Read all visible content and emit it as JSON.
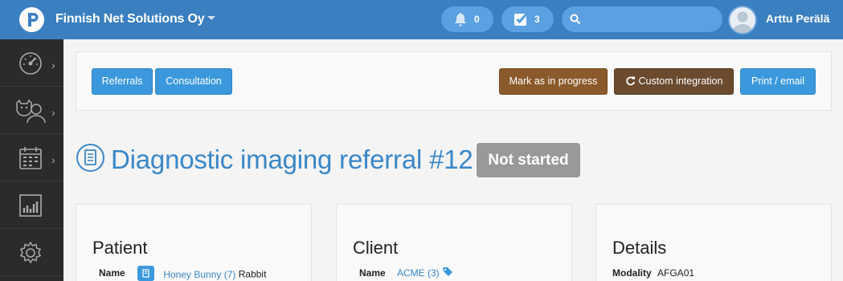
{
  "header": {
    "org_name": "Finnish Net Solutions Oy",
    "notifications_count": "0",
    "tasks_count": "3",
    "search_placeholder": "",
    "user_name": "Arttu Perälä"
  },
  "sidebar": {
    "items": [
      {
        "icon": "dashboard-icon",
        "has_submenu": true
      },
      {
        "icon": "patients-icon",
        "has_submenu": true
      },
      {
        "icon": "calendar-icon",
        "has_submenu": true
      },
      {
        "icon": "reports-icon",
        "has_submenu": false
      },
      {
        "icon": "settings-icon",
        "has_submenu": false
      }
    ]
  },
  "actions": {
    "referrals": "Referrals",
    "consultation": "Consultation",
    "mark_in_progress": "Mark as in progress",
    "custom_integration": "Custom integration",
    "print_email": "Print / email"
  },
  "page": {
    "title": "Diagnostic imaging referral #12",
    "status": "Not started"
  },
  "patient": {
    "heading": "Patient",
    "name_label": "Name",
    "name_link": "Honey Bunny (7)",
    "species": "Rabbit"
  },
  "client": {
    "heading": "Client",
    "name_label": "Name",
    "name_link": "ACME (3)"
  },
  "details": {
    "heading": "Details",
    "modality_label": "Modality",
    "modality_value": "AFGA01"
  },
  "colors": {
    "topbar": "#3a7fc0",
    "accent_blue": "#3b98dc",
    "brown": "#8b5a2b",
    "dark_brown": "#6b4a2e",
    "status_gray": "#999999",
    "title_blue": "#3a87c8"
  }
}
